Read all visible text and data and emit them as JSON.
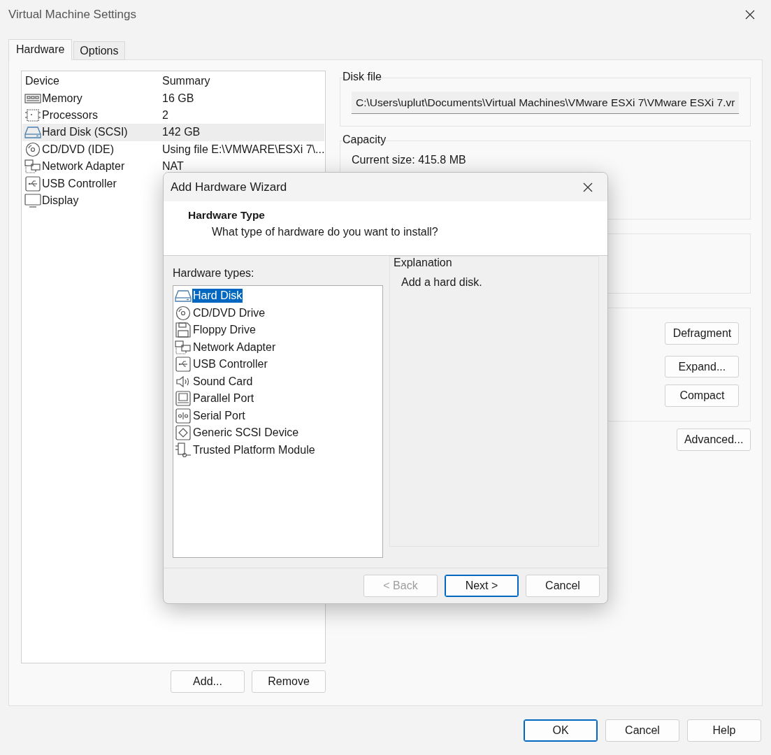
{
  "window": {
    "title": "Virtual Machine Settings"
  },
  "tabs": [
    {
      "label": "Hardware",
      "selected": true
    },
    {
      "label": "Options",
      "selected": false
    }
  ],
  "device_table": {
    "columns": [
      "Device",
      "Summary"
    ],
    "rows": [
      {
        "kind": "memory",
        "device": "Memory",
        "summary": "16 GB",
        "selected": false
      },
      {
        "kind": "cpu",
        "device": "Processors",
        "summary": "2",
        "selected": false
      },
      {
        "kind": "disk",
        "device": "Hard Disk (SCSI)",
        "summary": "142 GB",
        "selected": true
      },
      {
        "kind": "cd",
        "device": "CD/DVD (IDE)",
        "summary": "Using file E:\\VMWARE\\ESXi 7\\...",
        "selected": false
      },
      {
        "kind": "network",
        "device": "Network Adapter",
        "summary": "NAT",
        "selected": false
      },
      {
        "kind": "usb",
        "device": "USB Controller",
        "selected": false
      },
      {
        "kind": "display",
        "device": "Display",
        "selected": false
      }
    ]
  },
  "device_buttons": [
    "Add...",
    "Remove"
  ],
  "disk_file": {
    "label": "Disk file",
    "value": "C:\\Users\\uplut\\Documents\\Virtual Machines\\VMware ESXi 7\\VMware ESXi 7.vr"
  },
  "capacity": {
    "label": "Capacity",
    "current_size": "Current size: 415.8 MB"
  },
  "utility_buttons": [
    "Defragment",
    "Expand...",
    "Compact"
  ],
  "advanced_button": "Advanced...",
  "footer_buttons": [
    "OK",
    "Cancel",
    "Help"
  ],
  "wizard": {
    "title": "Add Hardware Wizard",
    "heading": "Hardware Type",
    "subheading": "What type of hardware do you want to install?",
    "list_label": "Hardware types:",
    "types": [
      {
        "kind": "disk",
        "label": "Hard Disk",
        "selected": true
      },
      {
        "kind": "cd",
        "label": "CD/DVD Drive",
        "selected": false
      },
      {
        "kind": "floppy",
        "label": "Floppy Drive",
        "selected": false
      },
      {
        "kind": "network",
        "label": "Network Adapter",
        "selected": false
      },
      {
        "kind": "usb",
        "label": "USB Controller",
        "selected": false
      },
      {
        "kind": "sound",
        "label": "Sound Card",
        "selected": false
      },
      {
        "kind": "parallel",
        "label": "Parallel Port",
        "selected": false
      },
      {
        "kind": "serial",
        "label": "Serial Port",
        "selected": false
      },
      {
        "kind": "scsi",
        "label": "Generic SCSI Device",
        "selected": false
      },
      {
        "kind": "tpm",
        "label": "Trusted Platform Module",
        "selected": false
      }
    ],
    "explanation_label": "Explanation",
    "explanation": "Add a hard disk.",
    "buttons": [
      {
        "label": "< Back",
        "disabled": true,
        "default": false
      },
      {
        "label": "Next >",
        "disabled": false,
        "default": true
      },
      {
        "label": "Cancel",
        "disabled": false,
        "default": false
      }
    ]
  }
}
